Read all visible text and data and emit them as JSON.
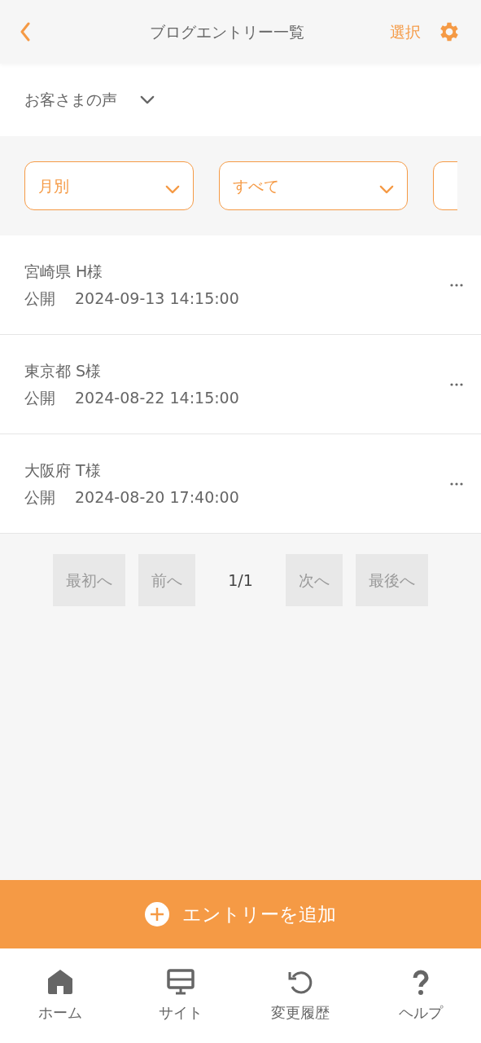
{
  "header": {
    "title": "ブログエントリー一覧",
    "select": "選択"
  },
  "category": {
    "label": "お客さまの声"
  },
  "filters": [
    {
      "value": "月別"
    },
    {
      "value": "すべて"
    }
  ],
  "entries": [
    {
      "title": "宮崎県 H様",
      "status": "公開",
      "datetime": "2024-09-13 14:15:00"
    },
    {
      "title": "東京都 S様",
      "status": "公開",
      "datetime": "2024-08-22 14:15:00"
    },
    {
      "title": "大阪府 T様",
      "status": "公開",
      "datetime": "2024-08-20 17:40:00"
    }
  ],
  "pagination": {
    "first": {
      "label": "最初へ",
      "disabled": true
    },
    "prev": {
      "label": "前へ",
      "disabled": true
    },
    "page": "1/1",
    "next": {
      "label": "次へ",
      "disabled": true
    },
    "last": {
      "label": "最後へ",
      "disabled": true
    }
  },
  "add_button": {
    "label": "エントリーを追加"
  },
  "bottom_nav": [
    {
      "kind": "home",
      "label": "ホーム"
    },
    {
      "kind": "site",
      "label": "サイト"
    },
    {
      "kind": "history",
      "label": "変更履歴"
    },
    {
      "kind": "help",
      "label": "ヘルプ"
    }
  ]
}
